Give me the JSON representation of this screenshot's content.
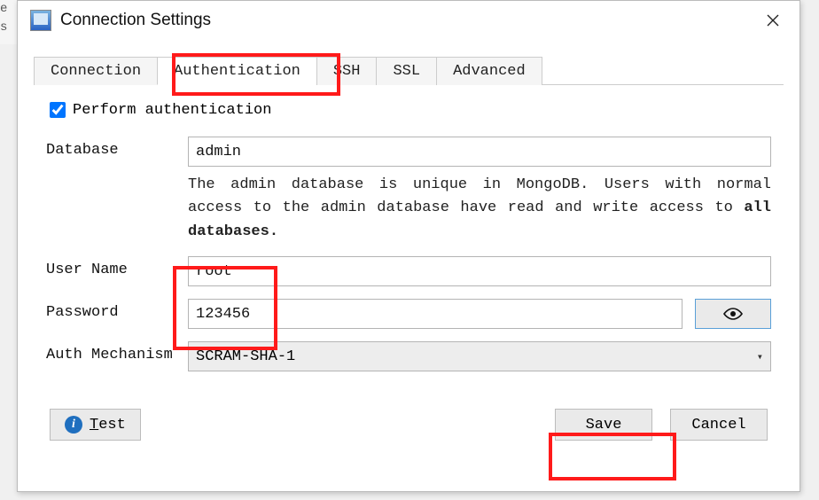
{
  "backdrop": {
    "l1": "e",
    "l2": "s"
  },
  "titlebar": {
    "title": "Connection Settings"
  },
  "tabs": {
    "connection": "Connection",
    "authentication": "Authentication",
    "ssh": "SSH",
    "ssl": "SSL",
    "advanced": "Advanced"
  },
  "auth": {
    "perform_label": "Perform authentication",
    "perform_checked": true,
    "database_label": "Database",
    "database_value": "admin",
    "helper_pre": "The admin database is unique in MongoDB. Users with normal access to the admin database have read and write access to ",
    "helper_bold": "all databases.",
    "username_label": "User Name",
    "username_value": "root",
    "password_label": "Password",
    "password_value": "123456",
    "mechanism_label": "Auth Mechanism",
    "mechanism_value": "SCRAM-SHA-1"
  },
  "buttons": {
    "test_prefix": "T",
    "test_rest": "est",
    "save": "Save",
    "cancel": "Cancel"
  }
}
